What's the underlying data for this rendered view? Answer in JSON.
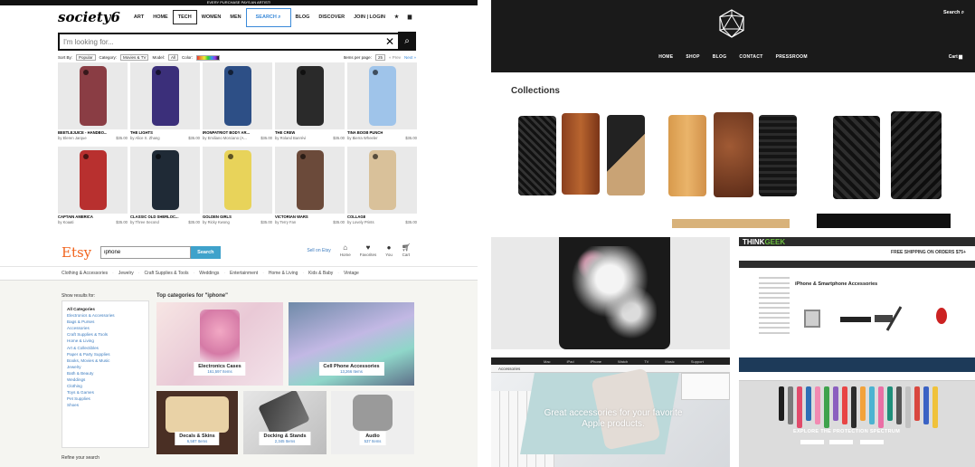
{
  "society6": {
    "promo": "EVERY PURCHASE PAYS AN ARTIST!",
    "logo": "society6",
    "nav": [
      "ART",
      "HOME",
      "TECH",
      "WOMEN",
      "MEN",
      "SEARCH",
      "BLOG",
      "DISCOVER",
      "JOIN | LOGIN"
    ],
    "search_placeholder": "I'm looking for...",
    "filters": {
      "sort_label": "Sort By:",
      "sort_value": "Popular",
      "category_label": "Category:",
      "category_value": "Movies & TV",
      "model_label": "Model:",
      "model_value": "All",
      "color_label": "Color:",
      "per_page_label": "Items per page:",
      "per_page_value": "25",
      "prev": "« Prev",
      "next": "Next »"
    },
    "products": [
      {
        "title": "BEETLEJUICE - HANDBO...",
        "artist": "by Eleren Jarque",
        "price": "$35.00",
        "color": "#8a3d44"
      },
      {
        "title": "THE LIGHTS",
        "artist": "by Alice X. Zhang",
        "price": "$35.00",
        "color": "#3b2f7a"
      },
      {
        "title": "IRONPATRIOT BODY AR...",
        "artist": "by Emiliano Morciano (A...",
        "price": "$35.00",
        "color": "#2d4f86"
      },
      {
        "title": "THE CREW",
        "artist": "by Roland Banrévi",
        "price": "$35.00",
        "color": "#2a2a2a"
      },
      {
        "title": "TINA BOOB PUNCH",
        "artist": "by Bierra Wheeler",
        "price": "$35.00",
        "color": "#9fc4ea"
      },
      {
        "title": "CAPTAIN AMERICA",
        "artist": "by Koaati",
        "price": "$35.00",
        "color": "#b8302f"
      },
      {
        "title": "CLASSIC OLD SHERLOC...",
        "artist": "by Three Second",
        "price": "$35.00",
        "color": "#1f2a36"
      },
      {
        "title": "GOLDEN GIRLS",
        "artist": "by Ricky Kwong",
        "price": "$35.00",
        "color": "#e8d35a"
      },
      {
        "title": "VICTORIAN WARS",
        "artist": "by Terry Fan",
        "price": "$35.00",
        "color": "#6b4a3a"
      },
      {
        "title": "COLLAGE",
        "artist": "by Lovely Prints",
        "price": "$35.00",
        "color": "#d9c19a"
      }
    ]
  },
  "store": {
    "search": "Search",
    "menu": [
      "HOME",
      "SHOP",
      "BLOG",
      "CONTACT",
      "PRESSROOM"
    ],
    "cart": "Cart",
    "collections_title": "Collections"
  },
  "etsy": {
    "logo": "Etsy",
    "search_value": "iphone",
    "search_button": "Search",
    "sell_link": "Sell on Etsy",
    "icons": [
      "Home",
      "Favorites",
      "You",
      "Cart"
    ],
    "categories": [
      "Clothing & Accessories",
      "Jewelry",
      "Craft Supplies & Tools",
      "Weddings",
      "Entertainment",
      "Home & Living",
      "Kids & Baby",
      "Vintage"
    ],
    "sidebar_heading": "Show results for:",
    "sidebar_items": [
      "All Categories",
      "Electronics & Accessories",
      "Bags & Purses",
      "Accessories",
      "Craft Supplies & Tools",
      "Home & Living",
      "Art & Collectibles",
      "Paper & Party Supplies",
      "Books, Movies & Music",
      "Jewelry",
      "Bath & Beauty",
      "Weddings",
      "Clothing",
      "Toys & Games",
      "Pet Supplies",
      "Shoes"
    ],
    "refine": "Refine your search",
    "top_heading": "Top categories for \"iphone\"",
    "tiles": [
      {
        "name": "Electronics Cases",
        "count": "161,597 Items"
      },
      {
        "name": "Cell Phone Accessories",
        "count": "13,266 Items"
      },
      {
        "name": "Decals & Skins",
        "count": "6,587 Items"
      },
      {
        "name": "Docking & Stands",
        "count": "2,345 Items"
      },
      {
        "name": "Audio",
        "count": "537 Items"
      }
    ]
  },
  "thinkgeek": {
    "logo_a": "THINK",
    "logo_b": "GEEK",
    "shipping": "FREE SHIPPING ON ORDERS $75+",
    "title": "iPhone & Smartphone Accessories"
  },
  "apple": {
    "subnav": "Accessories",
    "hero_text": "Great accessories for your favorite Apple products."
  },
  "otterbox": {
    "hero_text": "EXPLORE THE PROTECTION SPECTRUM"
  }
}
